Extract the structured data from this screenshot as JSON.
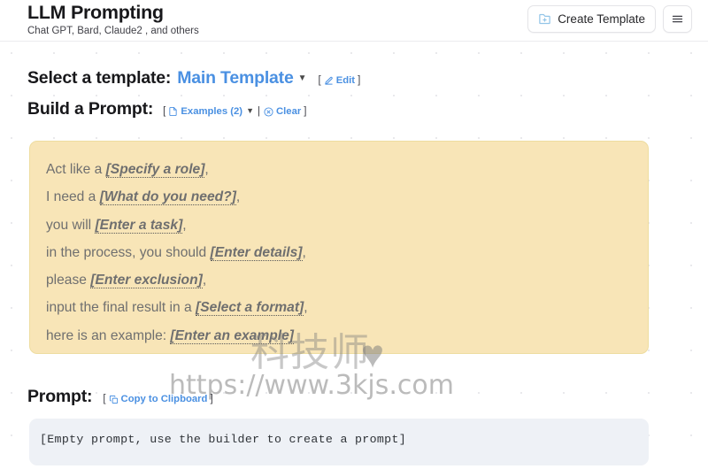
{
  "header": {
    "title": "LLM Prompting",
    "subtitle": "Chat GPT, Bard, Claude2 , and others",
    "create_template_label": "Create Template",
    "create_template_icon": "folder-plus-icon",
    "menu_icon": "hamburger-menu-icon"
  },
  "template_section": {
    "label": "Select a template:",
    "selected": "Main Template",
    "caret": "▼",
    "bracket_open": "[",
    "bracket_close": "]",
    "edit_label": "Edit",
    "edit_icon": "pencil-icon"
  },
  "build_section": {
    "label": "Build a Prompt:",
    "bracket_open": "[",
    "bracket_close": "]",
    "examples_label": "Examples (2)",
    "examples_icon": "document-icon",
    "caret": "▼",
    "separator": "|",
    "clear_label": "Clear",
    "clear_icon": "circle-x-icon"
  },
  "builder": {
    "lines": [
      {
        "prefix": "Act like a ",
        "placeholder": "[Specify a role]",
        "suffix": ","
      },
      {
        "prefix": "I need a ",
        "placeholder": "[What do you need?]",
        "suffix": ","
      },
      {
        "prefix": "you will ",
        "placeholder": "[Enter a task]",
        "suffix": ","
      },
      {
        "prefix": "in the process, you should ",
        "placeholder": "[Enter details]",
        "suffix": ","
      },
      {
        "prefix": "please ",
        "placeholder": "[Enter exclusion]",
        "suffix": ","
      },
      {
        "prefix": "input the final result in a ",
        "placeholder": "[Select a format]",
        "suffix": ","
      },
      {
        "prefix": "here is an example: ",
        "placeholder": "[Enter an example]",
        "suffix": ""
      }
    ]
  },
  "prompt_section": {
    "label": "Prompt:",
    "bracket_open": "[",
    "bracket_close": "]",
    "copy_label": "Copy to Clipboard",
    "copy_icon": "clipboard-copy-icon",
    "output_text": "[Empty prompt, use the builder to create a prompt]"
  },
  "watermark": {
    "text_cn": "科技师",
    "heart": "♥",
    "url": "https://www.3kjs.com"
  },
  "colors": {
    "accent_blue": "#4a90e2",
    "builder_bg": "#f8e5b7",
    "builder_border": "#eedda0",
    "output_bg": "#eef1f6",
    "text_dark": "#18181b",
    "text_muted": "#6f6f6f"
  }
}
